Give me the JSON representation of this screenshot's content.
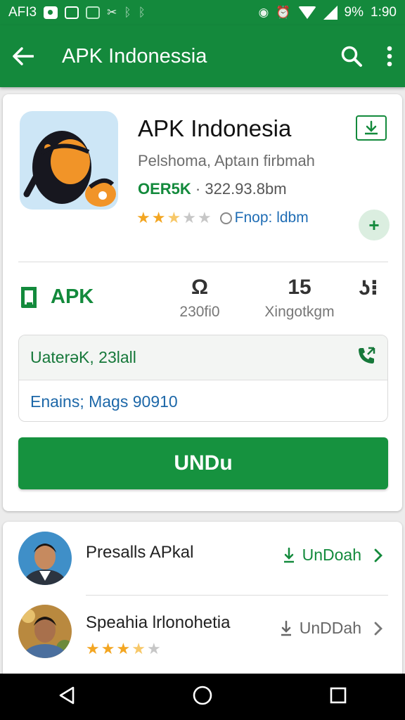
{
  "status_bar": {
    "left_text": "AFI3",
    "battery": "9%",
    "time": "1:90"
  },
  "app_bar": {
    "title": "APK Indonessia",
    "icons": [
      "back-arrow-icon",
      "search-icon",
      "overflow-menu-icon"
    ]
  },
  "app": {
    "name": "APK Indonesia",
    "subtitle": "Pelshoma, Aptaın firbmah",
    "version_code": "OER5K",
    "version_size": "· 322.93.8bm",
    "stars_filled": 2.5,
    "stars_total": 5,
    "rating_info": "Fnop: ldbm"
  },
  "stats": {
    "badge": "APK",
    "stat1_value": "Ω",
    "stat1_label": "230fi0",
    "stat2_value": "15",
    "stat2_label": "Xingotkgm",
    "stat3_value": "ʖ⁝"
  },
  "info_box": {
    "line1": "UaterəK, 23lall",
    "line2": "Enains; Mags 90910"
  },
  "download_button": "UNDu",
  "list": [
    {
      "title": "Presalls APkal",
      "action": "UnDoah"
    },
    {
      "title": "Speahia lrlonohetia",
      "action": "UnDDah",
      "stars_filled": 3.5
    }
  ],
  "colors": {
    "primary": "#14893c",
    "button": "#16923f",
    "link": "#1c67a8",
    "star": "#f3a622"
  }
}
